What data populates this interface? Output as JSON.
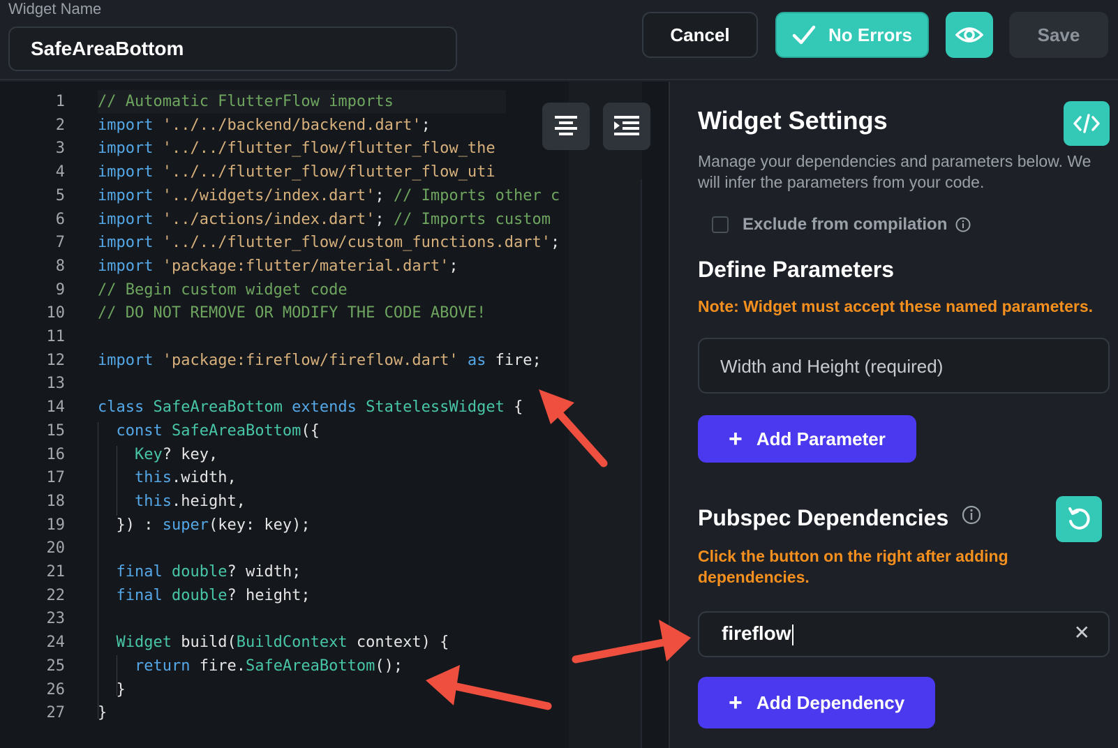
{
  "header": {
    "widget_name_label": "Widget Name",
    "widget_name_value": "SafeAreaBottom",
    "cancel_label": "Cancel",
    "status_label": "No Errors",
    "save_label": "Save"
  },
  "editor": {
    "lines": [
      {
        "n": "1",
        "segs": [
          [
            "cm",
            "// Automatic FlutterFlow imports"
          ]
        ]
      },
      {
        "n": "2",
        "segs": [
          [
            "kw",
            "import"
          ],
          [
            "",
            " "
          ],
          [
            "st",
            "'../../backend/backend.dart'"
          ],
          [
            "",
            ";"
          ]
        ]
      },
      {
        "n": "3",
        "segs": [
          [
            "kw",
            "import"
          ],
          [
            "",
            " "
          ],
          [
            "st",
            "'../../flutter_flow/flutter_flow_the"
          ]
        ]
      },
      {
        "n": "4",
        "segs": [
          [
            "kw",
            "import"
          ],
          [
            "",
            " "
          ],
          [
            "st",
            "'../../flutter_flow/flutter_flow_uti"
          ]
        ]
      },
      {
        "n": "5",
        "segs": [
          [
            "kw",
            "import"
          ],
          [
            "",
            " "
          ],
          [
            "st",
            "'../widgets/index.dart'"
          ],
          [
            "",
            "; "
          ],
          [
            "cm",
            "// Imports other c"
          ]
        ]
      },
      {
        "n": "6",
        "segs": [
          [
            "kw",
            "import"
          ],
          [
            "",
            " "
          ],
          [
            "st",
            "'../actions/index.dart'"
          ],
          [
            "",
            "; "
          ],
          [
            "cm",
            "// Imports custom"
          ]
        ]
      },
      {
        "n": "7",
        "segs": [
          [
            "kw",
            "import"
          ],
          [
            "",
            " "
          ],
          [
            "st",
            "'../../flutter_flow/custom_functions.dart'"
          ],
          [
            "",
            ";"
          ]
        ]
      },
      {
        "n": "8",
        "segs": [
          [
            "kw",
            "import"
          ],
          [
            "",
            " "
          ],
          [
            "st",
            "'package:flutter/material.dart'"
          ],
          [
            "",
            ";"
          ]
        ]
      },
      {
        "n": "9",
        "segs": [
          [
            "cm",
            "// Begin custom widget code"
          ]
        ]
      },
      {
        "n": "10",
        "segs": [
          [
            "cm",
            "// DO NOT REMOVE OR MODIFY THE CODE ABOVE!"
          ]
        ]
      },
      {
        "n": "11",
        "segs": []
      },
      {
        "n": "12",
        "segs": [
          [
            "kw",
            "import"
          ],
          [
            "",
            " "
          ],
          [
            "st",
            "'package:fireflow/fireflow.dart'"
          ],
          [
            "",
            " "
          ],
          [
            "kw",
            "as"
          ],
          [
            "",
            " fire;"
          ]
        ]
      },
      {
        "n": "13",
        "segs": []
      },
      {
        "n": "14",
        "segs": [
          [
            "kw",
            "class"
          ],
          [
            "",
            " "
          ],
          [
            "ty",
            "SafeAreaBottom"
          ],
          [
            "",
            " "
          ],
          [
            "kw",
            "extends"
          ],
          [
            "",
            " "
          ],
          [
            "ty",
            "StatelessWidget"
          ],
          [
            "",
            " {"
          ]
        ]
      },
      {
        "n": "15",
        "segs": [
          [
            "",
            "  "
          ],
          [
            "kw",
            "const"
          ],
          [
            "",
            " "
          ],
          [
            "ty",
            "SafeAreaBottom"
          ],
          [
            "",
            "({"
          ]
        ]
      },
      {
        "n": "16",
        "segs": [
          [
            "",
            "    "
          ],
          [
            "ty",
            "Key"
          ],
          [
            "",
            "? key,"
          ]
        ]
      },
      {
        "n": "17",
        "segs": [
          [
            "",
            "    "
          ],
          [
            "kw",
            "this"
          ],
          [
            "",
            ".width,"
          ]
        ]
      },
      {
        "n": "18",
        "segs": [
          [
            "",
            "    "
          ],
          [
            "kw",
            "this"
          ],
          [
            "",
            ".height,"
          ]
        ]
      },
      {
        "n": "19",
        "segs": [
          [
            "",
            "  }) : "
          ],
          [
            "kw",
            "super"
          ],
          [
            "",
            "(key: key);"
          ]
        ]
      },
      {
        "n": "20",
        "segs": []
      },
      {
        "n": "21",
        "segs": [
          [
            "",
            "  "
          ],
          [
            "kw",
            "final"
          ],
          [
            "",
            " "
          ],
          [
            "ty",
            "double"
          ],
          [
            "",
            "? width;"
          ]
        ]
      },
      {
        "n": "22",
        "segs": [
          [
            "",
            "  "
          ],
          [
            "kw",
            "final"
          ],
          [
            "",
            " "
          ],
          [
            "ty",
            "double"
          ],
          [
            "",
            "? height;"
          ]
        ]
      },
      {
        "n": "23",
        "segs": []
      },
      {
        "n": "24",
        "segs": [
          [
            "",
            "  "
          ],
          [
            "ty",
            "Widget"
          ],
          [
            "",
            " build("
          ],
          [
            "ty",
            "BuildContext"
          ],
          [
            "",
            " context) {"
          ]
        ]
      },
      {
        "n": "25",
        "segs": [
          [
            "",
            "    "
          ],
          [
            "kw",
            "return"
          ],
          [
            "",
            " fire."
          ],
          [
            "ty",
            "SafeAreaBottom"
          ],
          [
            "",
            "();"
          ]
        ]
      },
      {
        "n": "26",
        "segs": [
          [
            "",
            "  }"
          ]
        ]
      },
      {
        "n": "27",
        "segs": [
          [
            "",
            "}"
          ]
        ]
      }
    ]
  },
  "panel": {
    "title": "Widget Settings",
    "description": "Manage your dependencies and parameters below. We will infer the parameters from your code.",
    "exclude_label": "Exclude from compilation",
    "define_title": "Define Parameters",
    "define_note": "Note: Widget must accept these named parameters.",
    "param_placeholder": "Width and Height (required)",
    "add_param_label": "Add Parameter",
    "pubspec_title": "Pubspec Dependencies",
    "pubspec_note": "Click the button on the right after adding dependencies.",
    "dependency_value": "fireflow",
    "add_dep_label": "Add Dependency"
  },
  "colors": {
    "accent_teal": "#33c9b6",
    "primary_purple": "#4b39ef",
    "warning_orange": "#f5901e",
    "annotation_red": "#ef4f3f"
  }
}
